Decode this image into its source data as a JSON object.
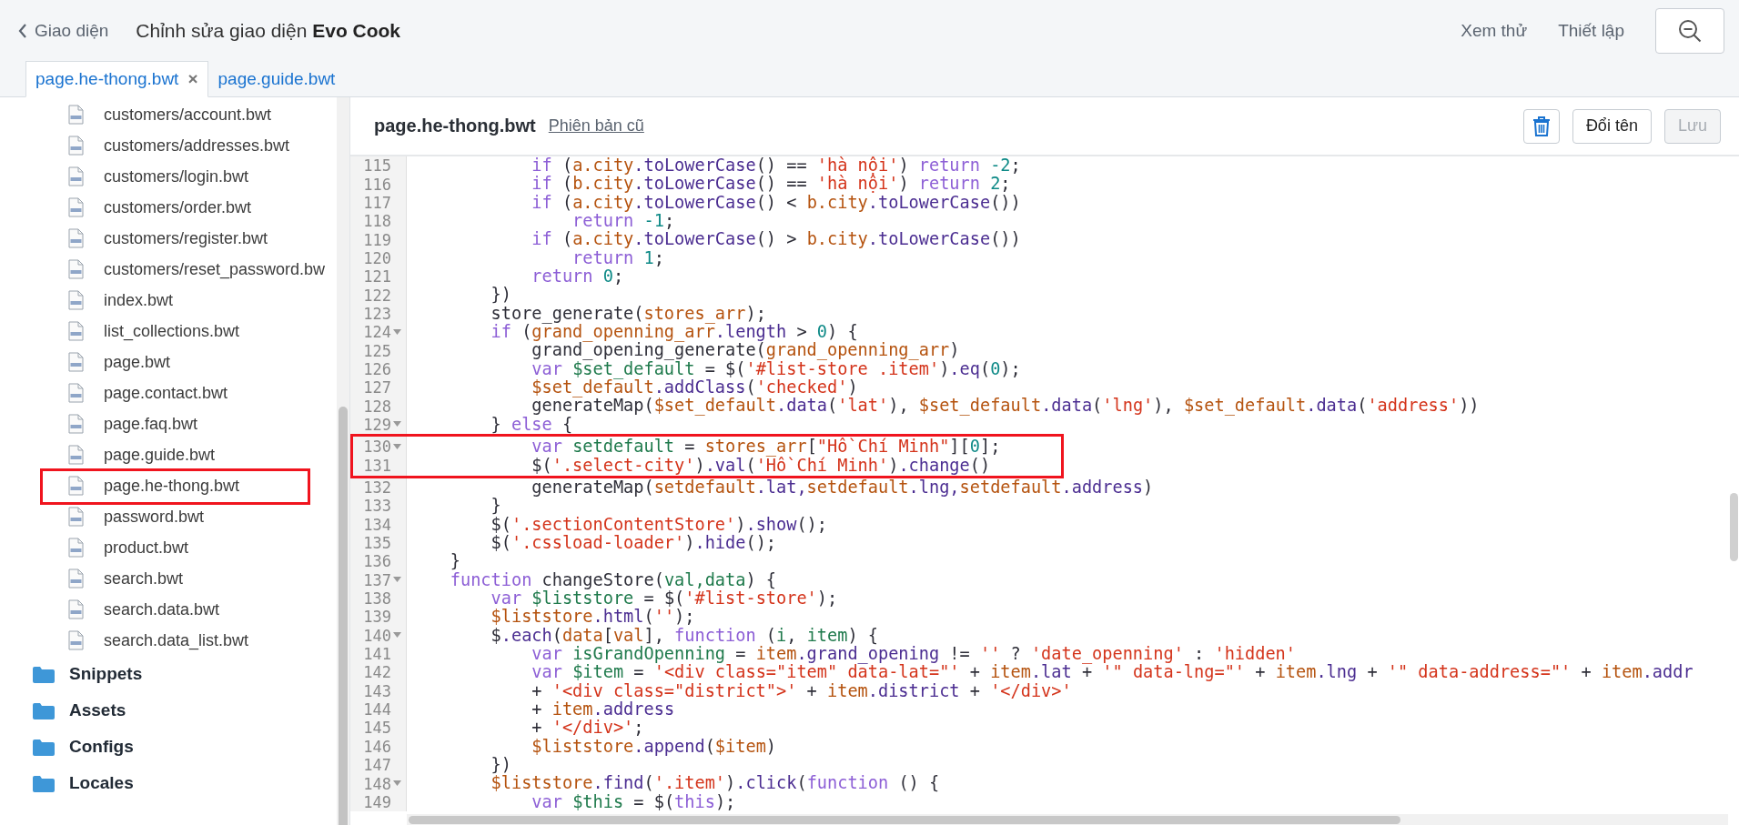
{
  "header": {
    "back_label": "Giao diện",
    "title": "Chỉnh sửa giao diện **Evo Cook**",
    "actions": [
      "Xem thử",
      "Thiết lập"
    ]
  },
  "tabs": [
    {
      "label": "page.he-thong.bwt",
      "selected": true,
      "close": "×"
    },
    {
      "label": "page.guide.bwt",
      "selected": false
    }
  ],
  "sidebar": {
    "files": [
      {
        "name": "customers/account.bwt",
        "highlighted": false
      },
      {
        "name": "customers/addresses.bwt",
        "highlighted": false
      },
      {
        "name": "customers/login.bwt",
        "highlighted": false
      },
      {
        "name": "customers/order.bwt",
        "highlighted": false
      },
      {
        "name": "customers/register.bwt",
        "highlighted": false
      },
      {
        "name": "customers/reset_password.bw",
        "highlighted": false
      },
      {
        "name": "index.bwt",
        "highlighted": false
      },
      {
        "name": "list_collections.bwt",
        "highlighted": false
      },
      {
        "name": "page.bwt",
        "highlighted": false
      },
      {
        "name": "page.contact.bwt",
        "highlighted": false
      },
      {
        "name": "page.faq.bwt",
        "highlighted": false
      },
      {
        "name": "page.guide.bwt",
        "highlighted": false
      },
      {
        "name": "page.he-thong.bwt",
        "highlighted": true
      },
      {
        "name": "password.bwt",
        "highlighted": false
      },
      {
        "name": "product.bwt",
        "highlighted": false
      },
      {
        "name": "search.bwt",
        "highlighted": false
      },
      {
        "name": "search.data.bwt",
        "highlighted": false
      },
      {
        "name": "search.data_list.bwt",
        "highlighted": false
      }
    ],
    "folders": [
      "Snippets",
      "Assets",
      "Configs",
      "Locales"
    ]
  },
  "editor": {
    "filename": "page.he-thong.bwt",
    "old_version_link": "Phiên bản cũ",
    "rename_button": {
      "label": "Đổi tên",
      "disabled": false
    },
    "save_button": {
      "label": "Lưu",
      "disabled": true
    },
    "lines": [
      {
        "n": "115",
        "fold": false,
        "highlighted": false,
        "tokens": [
          {
            "text": "            if",
            "kind": "kw"
          },
          {
            "text": " (",
            "kind": "p"
          },
          {
            "text": "a.city",
            "kind": "v"
          },
          {
            "text": ".toLowerCase",
            "kind": "m"
          },
          {
            "text": "() == ",
            "kind": "p"
          },
          {
            "text": "'hà nội'",
            "kind": "s"
          },
          {
            "text": ") ",
            "kind": "p"
          },
          {
            "text": "return ",
            "kind": "kw"
          },
          {
            "text": "-2",
            "kind": "n"
          },
          {
            "text": ";",
            "kind": "p"
          }
        ]
      },
      {
        "n": "116",
        "fold": false,
        "highlighted": false,
        "tokens": [
          {
            "text": "            if",
            "kind": "kw"
          },
          {
            "text": " (",
            "kind": "p"
          },
          {
            "text": "b.city",
            "kind": "v"
          },
          {
            "text": ".toLowerCase",
            "kind": "m"
          },
          {
            "text": "() == ",
            "kind": "p"
          },
          {
            "text": "'hà nội'",
            "kind": "s"
          },
          {
            "text": ") ",
            "kind": "p"
          },
          {
            "text": "return ",
            "kind": "kw"
          },
          {
            "text": "2",
            "kind": "n"
          },
          {
            "text": ";",
            "kind": "p"
          }
        ]
      },
      {
        "n": "117",
        "fold": false,
        "highlighted": false,
        "tokens": [
          {
            "text": "            if",
            "kind": "kw"
          },
          {
            "text": " (",
            "kind": "p"
          },
          {
            "text": "a.city",
            "kind": "v"
          },
          {
            "text": ".toLowerCase",
            "kind": "m"
          },
          {
            "text": "() < ",
            "kind": "p"
          },
          {
            "text": "b.city",
            "kind": "v"
          },
          {
            "text": ".toLowerCase",
            "kind": "m"
          },
          {
            "text": "())",
            "kind": "p"
          }
        ]
      },
      {
        "n": "118",
        "fold": false,
        "highlighted": false,
        "tokens": [
          {
            "text": "                return ",
            "kind": "kw"
          },
          {
            "text": "-1",
            "kind": "n"
          },
          {
            "text": ";",
            "kind": "p"
          }
        ]
      },
      {
        "n": "119",
        "fold": false,
        "highlighted": false,
        "tokens": [
          {
            "text": "            if",
            "kind": "kw"
          },
          {
            "text": " (",
            "kind": "p"
          },
          {
            "text": "a.city",
            "kind": "v"
          },
          {
            "text": ".toLowerCase",
            "kind": "m"
          },
          {
            "text": "() > ",
            "kind": "p"
          },
          {
            "text": "b.city",
            "kind": "v"
          },
          {
            "text": ".toLowerCase",
            "kind": "m"
          },
          {
            "text": "())",
            "kind": "p"
          }
        ]
      },
      {
        "n": "120",
        "fold": false,
        "highlighted": false,
        "tokens": [
          {
            "text": "                return ",
            "kind": "kw"
          },
          {
            "text": "1",
            "kind": "n"
          },
          {
            "text": ";",
            "kind": "p"
          }
        ]
      },
      {
        "n": "121",
        "fold": false,
        "highlighted": false,
        "tokens": [
          {
            "text": "            return ",
            "kind": "kw"
          },
          {
            "text": "0",
            "kind": "n"
          },
          {
            "text": ";",
            "kind": "p"
          }
        ]
      },
      {
        "n": "122",
        "fold": false,
        "highlighted": false,
        "tokens": [
          {
            "text": "        })",
            "kind": "p"
          }
        ]
      },
      {
        "n": "123",
        "fold": false,
        "highlighted": false,
        "tokens": [
          {
            "text": "        store_generate(",
            "kind": "p"
          },
          {
            "text": "stores_arr",
            "kind": "v"
          },
          {
            "text": ");",
            "kind": "p"
          }
        ]
      },
      {
        "n": "124",
        "fold": true,
        "highlighted": false,
        "tokens": [
          {
            "text": "        if",
            "kind": "kw"
          },
          {
            "text": " (",
            "kind": "p"
          },
          {
            "text": "grand_openning_arr",
            "kind": "v"
          },
          {
            "text": ".length",
            "kind": "m"
          },
          {
            "text": " > ",
            "kind": "p"
          },
          {
            "text": "0",
            "kind": "n"
          },
          {
            "text": ") {",
            "kind": "p"
          }
        ]
      },
      {
        "n": "125",
        "fold": false,
        "highlighted": false,
        "tokens": [
          {
            "text": "            grand_opening_generate(",
            "kind": "p"
          },
          {
            "text": "grand_openning_arr",
            "kind": "v"
          },
          {
            "text": ")",
            "kind": "p"
          }
        ]
      },
      {
        "n": "126",
        "fold": false,
        "highlighted": false,
        "tokens": [
          {
            "text": "            var ",
            "kind": "kw"
          },
          {
            "text": "$set_default",
            "kind": "d"
          },
          {
            "text": " = $(",
            "kind": "p"
          },
          {
            "text": "'#list-store .item'",
            "kind": "s"
          },
          {
            "text": ")",
            "kind": "p"
          },
          {
            "text": ".eq",
            "kind": "m"
          },
          {
            "text": "(",
            "kind": "p"
          },
          {
            "text": "0",
            "kind": "n"
          },
          {
            "text": ");",
            "kind": "p"
          }
        ]
      },
      {
        "n": "127",
        "fold": false,
        "highlighted": false,
        "tokens": [
          {
            "text": "            $set_default",
            "kind": "v"
          },
          {
            "text": ".addClass",
            "kind": "m"
          },
          {
            "text": "(",
            "kind": "p"
          },
          {
            "text": "'checked'",
            "kind": "s"
          },
          {
            "text": ")",
            "kind": "p"
          }
        ]
      },
      {
        "n": "128",
        "fold": false,
        "highlighted": false,
        "tokens": [
          {
            "text": "            generateMap(",
            "kind": "p"
          },
          {
            "text": "$set_default",
            "kind": "v"
          },
          {
            "text": ".data",
            "kind": "m"
          },
          {
            "text": "(",
            "kind": "p"
          },
          {
            "text": "'lat'",
            "kind": "s"
          },
          {
            "text": "), ",
            "kind": "p"
          },
          {
            "text": "$set_default",
            "kind": "v"
          },
          {
            "text": ".data",
            "kind": "m"
          },
          {
            "text": "(",
            "kind": "p"
          },
          {
            "text": "'lng'",
            "kind": "s"
          },
          {
            "text": "), ",
            "kind": "p"
          },
          {
            "text": "$set_default",
            "kind": "v"
          },
          {
            "text": ".data",
            "kind": "m"
          },
          {
            "text": "(",
            "kind": "p"
          },
          {
            "text": "'address'",
            "kind": "s"
          },
          {
            "text": "))",
            "kind": "p"
          }
        ]
      },
      {
        "n": "129",
        "fold": true,
        "highlighted": false,
        "tokens": [
          {
            "text": "        } ",
            "kind": "p"
          },
          {
            "text": "else",
            "kind": "kw"
          },
          {
            "text": " {",
            "kind": "p"
          }
        ]
      },
      {
        "n": "130",
        "fold": true,
        "highlighted": true,
        "tokens": [
          {
            "text": "            var ",
            "kind": "kw"
          },
          {
            "text": "setdefault",
            "kind": "d"
          },
          {
            "text": " = ",
            "kind": "p"
          },
          {
            "text": "stores_arr",
            "kind": "v"
          },
          {
            "text": "[",
            "kind": "p"
          },
          {
            "text": "\"Hồ Chí Minh\"",
            "kind": "s"
          },
          {
            "text": "][",
            "kind": "p"
          },
          {
            "text": "0",
            "kind": "n"
          },
          {
            "text": "];",
            "kind": "p"
          }
        ]
      },
      {
        "n": "131",
        "fold": false,
        "highlighted": true,
        "tokens": [
          {
            "text": "            $(",
            "kind": "p"
          },
          {
            "text": "'.select-city'",
            "kind": "s"
          },
          {
            "text": ")",
            "kind": "p"
          },
          {
            "text": ".val",
            "kind": "m"
          },
          {
            "text": "(",
            "kind": "p"
          },
          {
            "text": "'Hồ Chí Minh'",
            "kind": "s"
          },
          {
            "text": ")",
            "kind": "p"
          },
          {
            "text": ".change",
            "kind": "m"
          },
          {
            "text": "()",
            "kind": "p"
          }
        ]
      },
      {
        "n": "132",
        "fold": false,
        "highlighted": false,
        "tokens": [
          {
            "text": "            generateMap(",
            "kind": "p"
          },
          {
            "text": "setdefault",
            "kind": "v"
          },
          {
            "text": ".lat,",
            "kind": "m"
          },
          {
            "text": "setdefault",
            "kind": "v"
          },
          {
            "text": ".lng,",
            "kind": "m"
          },
          {
            "text": "setdefault",
            "kind": "v"
          },
          {
            "text": ".address",
            "kind": "m"
          },
          {
            "text": ")",
            "kind": "p"
          }
        ]
      },
      {
        "n": "133",
        "fold": false,
        "highlighted": false,
        "tokens": [
          {
            "text": "        }",
            "kind": "p"
          }
        ]
      },
      {
        "n": "134",
        "fold": false,
        "highlighted": false,
        "tokens": [
          {
            "text": "        $(",
            "kind": "p"
          },
          {
            "text": "'.sectionContentStore'",
            "kind": "s"
          },
          {
            "text": ")",
            "kind": "p"
          },
          {
            "text": ".show",
            "kind": "m"
          },
          {
            "text": "();",
            "kind": "p"
          }
        ]
      },
      {
        "n": "135",
        "fold": false,
        "highlighted": false,
        "tokens": [
          {
            "text": "        $(",
            "kind": "p"
          },
          {
            "text": "'.cssload-loader'",
            "kind": "s"
          },
          {
            "text": ")",
            "kind": "p"
          },
          {
            "text": ".hide",
            "kind": "m"
          },
          {
            "text": "();",
            "kind": "p"
          }
        ]
      },
      {
        "n": "136",
        "fold": false,
        "highlighted": false,
        "tokens": [
          {
            "text": "    }",
            "kind": "p"
          }
        ]
      },
      {
        "n": "137",
        "fold": true,
        "highlighted": false,
        "tokens": [
          {
            "text": "    function",
            "kind": "kw"
          },
          {
            "text": " changeStore(",
            "kind": "p"
          },
          {
            "text": "val,",
            "kind": "d"
          },
          {
            "text": "data",
            "kind": "d"
          },
          {
            "text": ") {",
            "kind": "p"
          }
        ]
      },
      {
        "n": "138",
        "fold": false,
        "highlighted": false,
        "tokens": [
          {
            "text": "        var ",
            "kind": "kw"
          },
          {
            "text": "$liststore",
            "kind": "d"
          },
          {
            "text": " = $(",
            "kind": "p"
          },
          {
            "text": "'#list-store'",
            "kind": "s"
          },
          {
            "text": ");",
            "kind": "p"
          }
        ]
      },
      {
        "n": "139",
        "fold": false,
        "highlighted": false,
        "tokens": [
          {
            "text": "        $liststore",
            "kind": "v"
          },
          {
            "text": ".html",
            "kind": "m"
          },
          {
            "text": "(",
            "kind": "p"
          },
          {
            "text": "''",
            "kind": "s"
          },
          {
            "text": ");",
            "kind": "p"
          }
        ]
      },
      {
        "n": "140",
        "fold": true,
        "highlighted": false,
        "tokens": [
          {
            "text": "        $",
            "kind": "p"
          },
          {
            "text": ".each",
            "kind": "m"
          },
          {
            "text": "(",
            "kind": "p"
          },
          {
            "text": "data",
            "kind": "v"
          },
          {
            "text": "[",
            "kind": "p"
          },
          {
            "text": "val",
            "kind": "v"
          },
          {
            "text": "], ",
            "kind": "p"
          },
          {
            "text": "function",
            "kind": "kw"
          },
          {
            "text": " (",
            "kind": "p"
          },
          {
            "text": "i",
            "kind": "d"
          },
          {
            "text": ", ",
            "kind": "p"
          },
          {
            "text": "item",
            "kind": "d"
          },
          {
            "text": ") {",
            "kind": "p"
          }
        ]
      },
      {
        "n": "141",
        "fold": false,
        "highlighted": false,
        "tokens": [
          {
            "text": "            var ",
            "kind": "kw"
          },
          {
            "text": "isGrandOpenning",
            "kind": "d"
          },
          {
            "text": " = ",
            "kind": "p"
          },
          {
            "text": "item",
            "kind": "v"
          },
          {
            "text": ".grand_opening",
            "kind": "m"
          },
          {
            "text": " != ",
            "kind": "p"
          },
          {
            "text": "''",
            "kind": "s"
          },
          {
            "text": " ? ",
            "kind": "p"
          },
          {
            "text": "'date_openning'",
            "kind": "s"
          },
          {
            "text": " : ",
            "kind": "p"
          },
          {
            "text": "'hidden'",
            "kind": "s"
          }
        ]
      },
      {
        "n": "142",
        "fold": false,
        "highlighted": false,
        "tokens": [
          {
            "text": "            var ",
            "kind": "kw"
          },
          {
            "text": "$item",
            "kind": "d"
          },
          {
            "text": " = ",
            "kind": "p"
          },
          {
            "text": "'<div class=\"item\" data-lat=\"'",
            "kind": "s"
          },
          {
            "text": " + ",
            "kind": "p"
          },
          {
            "text": "item",
            "kind": "v"
          },
          {
            "text": ".lat",
            "kind": "m"
          },
          {
            "text": " + ",
            "kind": "p"
          },
          {
            "text": "'\" data-lng=\"'",
            "kind": "s"
          },
          {
            "text": " + ",
            "kind": "p"
          },
          {
            "text": "item",
            "kind": "v"
          },
          {
            "text": ".lng",
            "kind": "m"
          },
          {
            "text": " + ",
            "kind": "p"
          },
          {
            "text": "'\" data-address=\"'",
            "kind": "s"
          },
          {
            "text": " + ",
            "kind": "p"
          },
          {
            "text": "item",
            "kind": "v"
          },
          {
            "text": ".addr",
            "kind": "m"
          }
        ]
      },
      {
        "n": "143",
        "fold": false,
        "highlighted": false,
        "tokens": [
          {
            "text": "            + ",
            "kind": "p"
          },
          {
            "text": "'<div class=\"district\">'",
            "kind": "s"
          },
          {
            "text": " + ",
            "kind": "p"
          },
          {
            "text": "item",
            "kind": "v"
          },
          {
            "text": ".district",
            "kind": "m"
          },
          {
            "text": " + ",
            "kind": "p"
          },
          {
            "text": "'</div>'",
            "kind": "s"
          }
        ]
      },
      {
        "n": "144",
        "fold": false,
        "highlighted": false,
        "tokens": [
          {
            "text": "            + ",
            "kind": "p"
          },
          {
            "text": "item",
            "kind": "v"
          },
          {
            "text": ".address",
            "kind": "m"
          }
        ]
      },
      {
        "n": "145",
        "fold": false,
        "highlighted": false,
        "tokens": [
          {
            "text": "            + ",
            "kind": "p"
          },
          {
            "text": "'</div>'",
            "kind": "s"
          },
          {
            "text": ";",
            "kind": "p"
          }
        ]
      },
      {
        "n": "146",
        "fold": false,
        "highlighted": false,
        "tokens": [
          {
            "text": "            $liststore",
            "kind": "v"
          },
          {
            "text": ".append",
            "kind": "m"
          },
          {
            "text": "(",
            "kind": "p"
          },
          {
            "text": "$item",
            "kind": "v"
          },
          {
            "text": ")",
            "kind": "p"
          }
        ]
      },
      {
        "n": "147",
        "fold": false,
        "highlighted": false,
        "tokens": [
          {
            "text": "        })",
            "kind": "p"
          }
        ]
      },
      {
        "n": "148",
        "fold": true,
        "highlighted": false,
        "tokens": [
          {
            "text": "        $liststore",
            "kind": "v"
          },
          {
            "text": ".find",
            "kind": "m"
          },
          {
            "text": "(",
            "kind": "p"
          },
          {
            "text": "'.item'",
            "kind": "s"
          },
          {
            "text": ")",
            "kind": "p"
          },
          {
            "text": ".click",
            "kind": "m"
          },
          {
            "text": "(",
            "kind": "p"
          },
          {
            "text": "function",
            "kind": "kw"
          },
          {
            "text": " () {",
            "kind": "p"
          }
        ]
      },
      {
        "n": "149",
        "fold": false,
        "highlighted": false,
        "tokens": [
          {
            "text": "            var ",
            "kind": "kw"
          },
          {
            "text": "$this",
            "kind": "d"
          },
          {
            "text": " = $(",
            "kind": "p"
          },
          {
            "text": "this",
            "kind": "kw"
          },
          {
            "text": ");",
            "kind": "p"
          }
        ]
      }
    ]
  }
}
